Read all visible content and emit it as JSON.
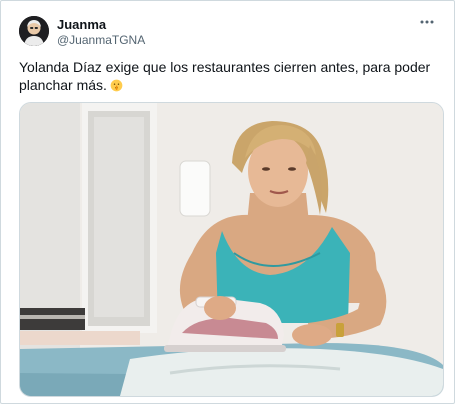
{
  "tweet": {
    "author": {
      "display_name": "Juanma",
      "handle": "@JuanmaTGNA",
      "avatar_icon": "avatar-icon"
    },
    "more_icon": "more-horizontal-icon",
    "text": "Yolanda Díaz exige que los restaurantes cierren antes, para poder planchar más.",
    "emoji_icon": "shushing-face-emoji",
    "media": {
      "kind": "photo",
      "icon": "photo-woman-ironing"
    }
  },
  "colors": {
    "text_primary": "#0f1419",
    "text_secondary": "#536471",
    "border": "#cfd9de"
  }
}
